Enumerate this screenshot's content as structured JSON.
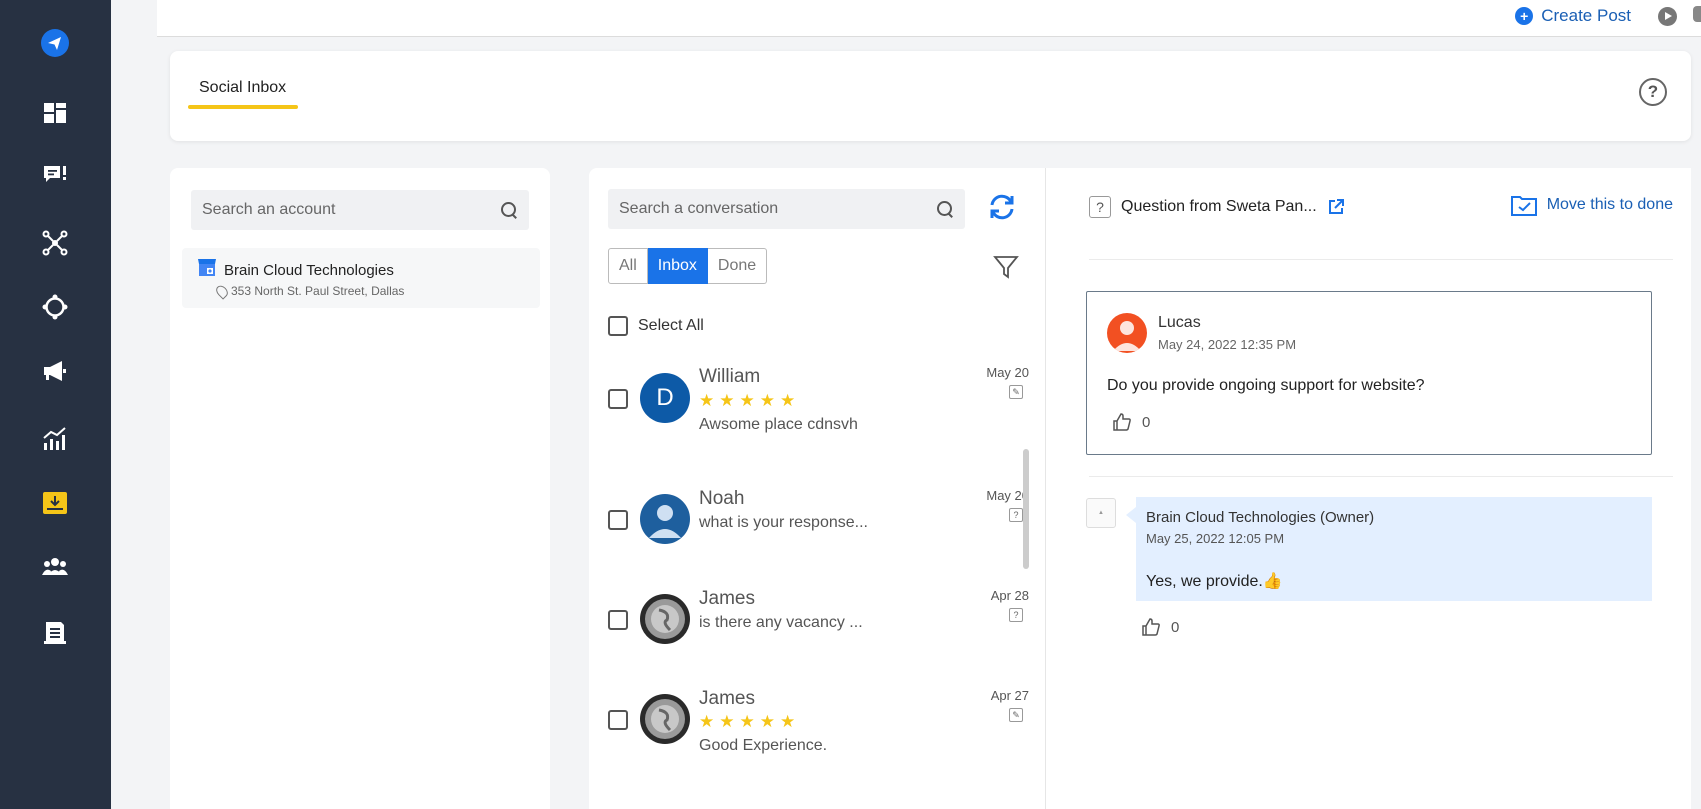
{
  "topbar": {
    "create_post_label": "Create Post"
  },
  "header": {
    "tab_label": "Social Inbox",
    "help_label": "?"
  },
  "accounts": {
    "search_placeholder": "Search an account",
    "items": [
      {
        "name": "Brain Cloud Technologies",
        "address": "353 North St. Paul Street, Dallas"
      }
    ]
  },
  "conversations": {
    "search_placeholder": "Search a conversation",
    "filters": [
      "All",
      "Inbox",
      "Done"
    ],
    "active_filter": "Inbox",
    "select_all_label": "Select All",
    "items": [
      {
        "name": "William",
        "avatar_initial": "D",
        "rating": 5,
        "stars": "★★★★★",
        "preview": "Awsome place cdnsvh",
        "date": "May 20",
        "type": "review"
      },
      {
        "name": "Noah",
        "avatar_initial": "",
        "stars": "",
        "preview": "what is your response...",
        "date": "May 20",
        "type": "question"
      },
      {
        "name": "James",
        "avatar_initial": "",
        "stars": "",
        "preview": "is there any vacancy ...",
        "date": "Apr 28",
        "type": "question"
      },
      {
        "name": "James",
        "avatar_initial": "",
        "rating": 5,
        "stars": "★★★★★",
        "preview": "Good Experience.",
        "date": "Apr 27",
        "type": "review"
      }
    ]
  },
  "detail": {
    "header_title": "Question from Sweta Pan...",
    "move_done_label": "Move this to done",
    "question": {
      "author": "Lucas",
      "date": "May 24, 2022 12:35 PM",
      "text": "Do you provide ongoing support for website?",
      "likes": "0"
    },
    "reply": {
      "author": "Brain Cloud Technologies (Owner)",
      "date": "May 25, 2022 12:05 PM",
      "text": "Yes, we provide.👍",
      "likes": "0"
    }
  },
  "colors": {
    "sidebar": "#273142",
    "accent": "#1a73e8",
    "highlight": "#f5c518",
    "reply_bg": "#e3efff"
  }
}
